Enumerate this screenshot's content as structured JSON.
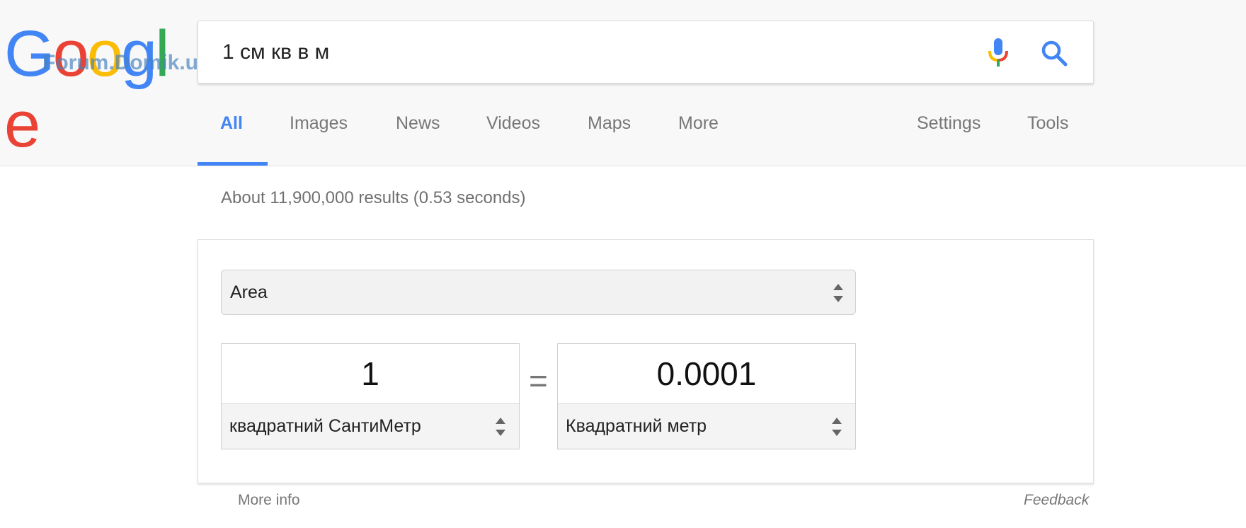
{
  "logo": {
    "letters": [
      "G",
      "o",
      "o",
      "g",
      "l",
      "e"
    ]
  },
  "watermark": "Forum.Domik.ua",
  "search": {
    "query": "1 см кв в м",
    "mic_icon": "microphone-icon",
    "search_icon": "search-icon"
  },
  "tabs": [
    {
      "label": "All",
      "active": true
    },
    {
      "label": "Images"
    },
    {
      "label": "News"
    },
    {
      "label": "Videos"
    },
    {
      "label": "Maps"
    },
    {
      "label": "More"
    }
  ],
  "tools": {
    "settings": "Settings",
    "tools": "Tools"
  },
  "stats": "About 11,900,000 results (0.53 seconds)",
  "converter": {
    "category": "Area",
    "equals": "=",
    "from": {
      "value": "1",
      "unit": "квадратний СантиМетр"
    },
    "to": {
      "value": "0.0001",
      "unit": "Квадратний метр"
    }
  },
  "footer": {
    "more_info": "More info",
    "feedback": "Feedback"
  },
  "colors": {
    "blue": "#4285f4",
    "red": "#ea4335",
    "yellow": "#fbbc05",
    "green": "#34a853"
  }
}
